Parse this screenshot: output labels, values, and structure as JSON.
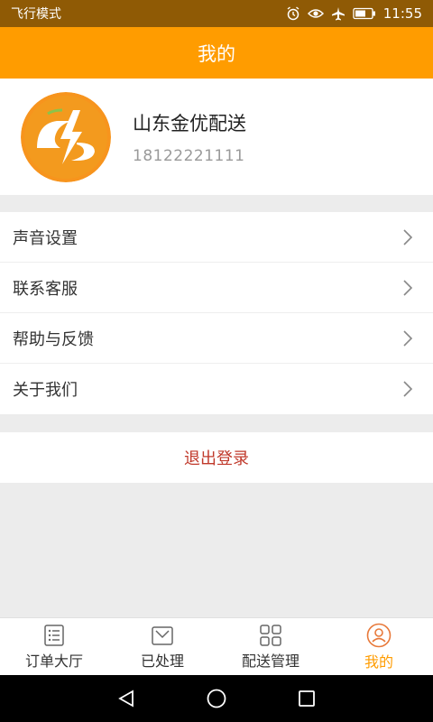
{
  "status_bar": {
    "mode": "飞行模式",
    "time": "11:55",
    "icons": [
      "alarm-icon",
      "eye-icon",
      "airplane-icon",
      "battery-icon"
    ]
  },
  "header": {
    "title": "我的"
  },
  "profile": {
    "name": "山东金优配送",
    "phone": "18122221111",
    "avatar_icon": "lightning-logo"
  },
  "menu": {
    "items": [
      {
        "label": "声音设置"
      },
      {
        "label": "联系客服"
      },
      {
        "label": "帮助与反馈"
      },
      {
        "label": "关于我们"
      }
    ]
  },
  "logout": {
    "label": "退出登录"
  },
  "tabbar": {
    "tabs": [
      {
        "label": "订单大厅",
        "icon": "order-list-icon",
        "active": false
      },
      {
        "label": "已处理",
        "icon": "processed-icon",
        "active": false
      },
      {
        "label": "配送管理",
        "icon": "grid-icon",
        "active": false
      },
      {
        "label": "我的",
        "icon": "user-icon",
        "active": true
      }
    ]
  },
  "colors": {
    "accent": "#ff9c00",
    "status_bar": "#8f5a05",
    "logout_text": "#c0392b",
    "background": "#ececec"
  }
}
